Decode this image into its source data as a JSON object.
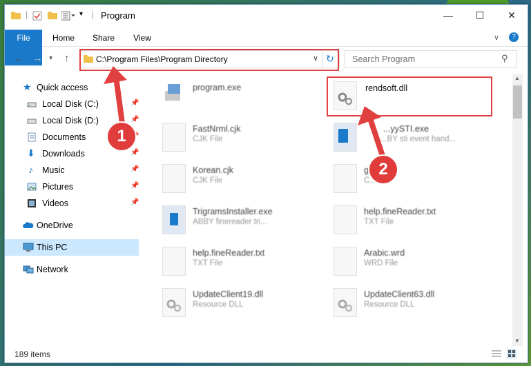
{
  "window": {
    "title": "Program"
  },
  "ribbon": {
    "tabs": [
      "File",
      "Home",
      "Share",
      "View"
    ]
  },
  "address": {
    "path": "C:\\Program Files\\Program Directory"
  },
  "search": {
    "placeholder": "Search Program"
  },
  "sidebar": {
    "items": [
      {
        "label": "Quick access",
        "icon": "star-icon"
      },
      {
        "label": "Local Disk (C:)",
        "icon": "drive-icon"
      },
      {
        "label": "Local Disk (D:)",
        "icon": "drive-icon"
      },
      {
        "label": "Documents",
        "icon": "documents-icon"
      },
      {
        "label": "Downloads",
        "icon": "download-icon"
      },
      {
        "label": "Music",
        "icon": "music-icon"
      },
      {
        "label": "Pictures",
        "icon": "pictures-icon"
      },
      {
        "label": "Videos",
        "icon": "videos-icon"
      },
      {
        "label": "OneDrive",
        "icon": "cloud-icon"
      },
      {
        "label": "This PC",
        "icon": "computer-icon"
      },
      {
        "label": "Network",
        "icon": "network-icon"
      }
    ]
  },
  "files": [
    {
      "name": "program.exe",
      "type": ""
    },
    {
      "name": "rendsoft.dll",
      "type": ""
    },
    {
      "name": "FastNrml.cjk",
      "type": "CJK File"
    },
    {
      "name": "...yySTI.exe",
      "type": "...BY sti event hand..."
    },
    {
      "name": "Korean.cjk",
      "type": "CJK File"
    },
    {
      "name": "gt...",
      "type": "C..."
    },
    {
      "name": "TrigramsInstaller.exe",
      "type": "ABBY finereader tri..."
    },
    {
      "name": "help.fineReader.txt",
      "type": "TXT File"
    },
    {
      "name": "help.fineReader.txt",
      "type": "TXT File"
    },
    {
      "name": "Arabic.wrd",
      "type": "WRD File"
    },
    {
      "name": "UpdateClient19.dll",
      "type": "Resource DLL"
    },
    {
      "name": "UpdateClient63.dll",
      "type": "Resource DLL"
    }
  ],
  "status": {
    "count": "189 items"
  },
  "annotations": {
    "badge1": "1",
    "badge2": "2"
  }
}
